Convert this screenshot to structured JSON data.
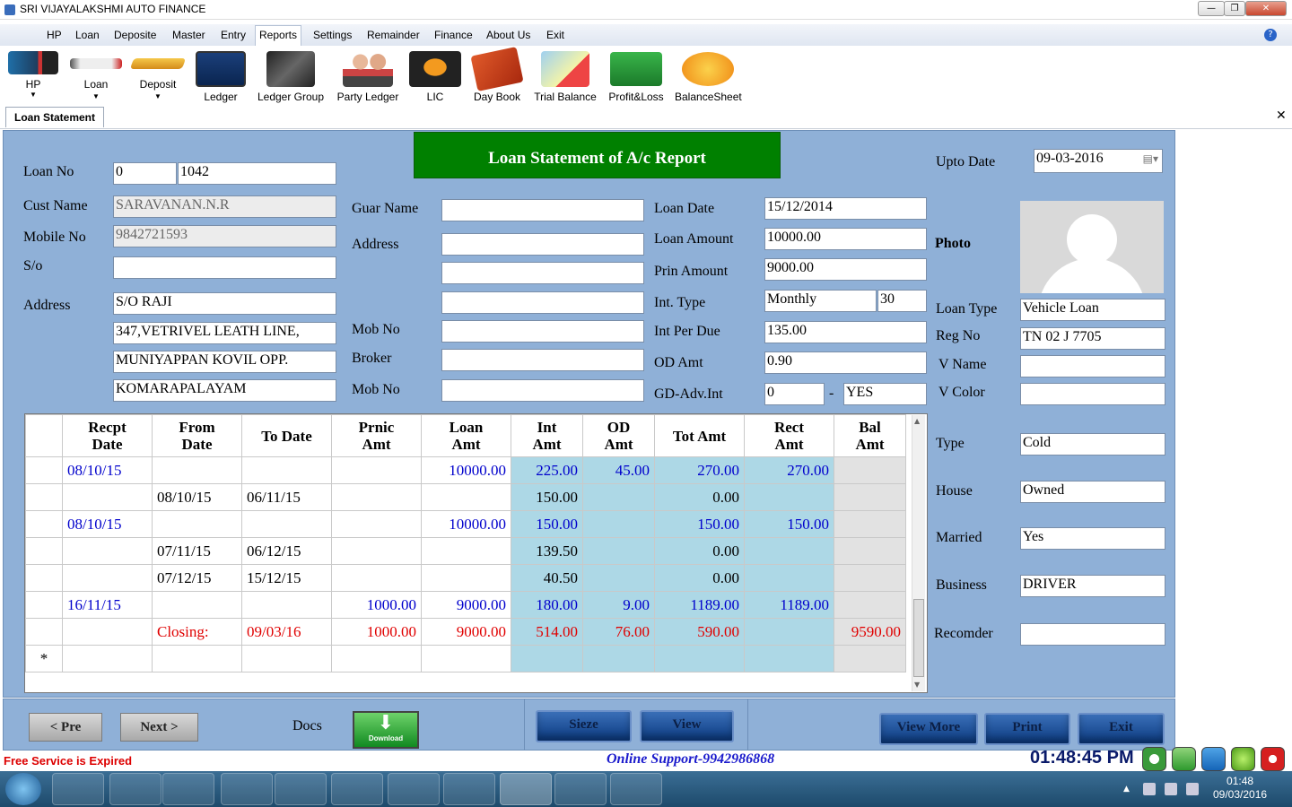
{
  "app": {
    "title": "SRI VIJAYALAKSHMI AUTO FINANCE"
  },
  "menu": [
    "HP",
    "Loan",
    "Deposite",
    "Master",
    "Entry",
    "Reports",
    "Settings",
    "Remainder",
    "Finance",
    "About Us",
    "Exit"
  ],
  "toolbar": [
    "HP",
    "Loan",
    "Deposit",
    "Ledger",
    "Ledger Group",
    "Party Ledger",
    "LIC",
    "Day Book",
    "Trial Balance",
    "Profit&Loss",
    "BalanceSheet"
  ],
  "tab": {
    "label": "Loan Statement"
  },
  "form": {
    "report_title": "Loan Statement of A/c Report",
    "upto_date_label": "Upto Date",
    "upto_date": "09-03-2016",
    "loan_no_label": "Loan No",
    "loan_no_prefix": "0",
    "loan_no": "1042",
    "cust_name_label": "Cust Name",
    "cust_name": "SARAVANAN.N.R",
    "mobile_label": "Mobile No",
    "mobile": "9842721593",
    "so_label": "S/o",
    "so": "",
    "address_label": "Address",
    "address": [
      "S/O RAJI",
      "347,VETRIVEL LEATH LINE,",
      "MUNIYAPPAN KOVIL OPP.",
      "KOMARAPALAYAM"
    ],
    "guar_name_label": "Guar Name",
    "guar_address_label": "Address",
    "guar_mob_label": "Mob No",
    "broker_label": "Broker",
    "broker_mob_label": "Mob No",
    "loan_date_label": "Loan Date",
    "loan_date": "15/12/2014",
    "loan_amount_label": "Loan Amount",
    "loan_amount": "10000.00",
    "prin_amount_label": "Prin Amount",
    "prin_amount": "9000.00",
    "int_type_label": "Int. Type",
    "int_type": "Monthly",
    "int_days": "30",
    "int_per_due_label": "Int Per Due",
    "int_per_due": "135.00",
    "od_amt_label": "OD Amt",
    "od_amt": "0.90",
    "gd_adv_label": "GD-Adv.Int",
    "gd_adv": "0",
    "gd_adv_sep": "-",
    "gd_adv_flag": "YES",
    "photo_label": "Photo",
    "loan_type_label": "Loan Type",
    "loan_type": "Vehicle Loan",
    "reg_no_label": "Reg No",
    "reg_no": "TN 02 J 7705",
    "v_name_label": "V Name",
    "v_color_label": "V Color",
    "type_label": "Type",
    "type": "Cold",
    "house_label": "House",
    "house": "Owned",
    "married_label": "Married",
    "married": "Yes",
    "business_label": "Business",
    "business": "DRIVER",
    "recomder_label": "Recomder"
  },
  "grid": {
    "headers": [
      [
        "Recpt",
        "Date"
      ],
      [
        "From",
        "Date"
      ],
      [
        "To Date",
        ""
      ],
      [
        "Prnic",
        "Amt"
      ],
      [
        "Loan",
        "Amt"
      ],
      [
        "Int",
        "Amt"
      ],
      [
        "OD",
        "Amt"
      ],
      [
        "Tot Amt",
        ""
      ],
      [
        "Rect",
        "Amt"
      ],
      [
        "Bal",
        "Amt"
      ]
    ],
    "rows": [
      {
        "c": [
          "08/10/15",
          "",
          "",
          "",
          "10000.00",
          "225.00",
          "45.00",
          "270.00",
          "270.00",
          ""
        ],
        "color": "blue"
      },
      {
        "c": [
          "",
          "08/10/15",
          "06/11/15",
          "",
          "",
          "150.00",
          "",
          "0.00",
          "",
          ""
        ],
        "color": "black"
      },
      {
        "c": [
          "08/10/15",
          "",
          "",
          "",
          "10000.00",
          "150.00",
          "",
          "150.00",
          "150.00",
          ""
        ],
        "color": "blue"
      },
      {
        "c": [
          "",
          "07/11/15",
          "06/12/15",
          "",
          "",
          "139.50",
          "",
          "0.00",
          "",
          ""
        ],
        "color": "black"
      },
      {
        "c": [
          "",
          "07/12/15",
          "15/12/15",
          "",
          "",
          "40.50",
          "",
          "0.00",
          "",
          ""
        ],
        "color": "black"
      },
      {
        "c": [
          "16/11/15",
          "",
          "",
          "1000.00",
          "9000.00",
          "180.00",
          "9.00",
          "1189.00",
          "1189.00",
          ""
        ],
        "color": "blue"
      },
      {
        "c": [
          "",
          "Closing:",
          "09/03/16",
          "1000.00",
          "9000.00",
          "514.00",
          "76.00",
          "590.00",
          "",
          "9590.00"
        ],
        "color": "red"
      }
    ],
    "new_row_marker": "*"
  },
  "buttons": {
    "pre": "< Pre",
    "next": "Next >",
    "docs_label": "Docs",
    "download": "Download",
    "sieze": "Sieze",
    "view": "View",
    "view_more": "View More",
    "print": "Print",
    "exit": "Exit"
  },
  "status": {
    "expired": "Free Service is Expired",
    "support": "Online Support-9942986868",
    "clock": "01:48:45 PM"
  },
  "tray": {
    "time": "01:48",
    "date": "09/03/2016"
  },
  "colors": {
    "panel": "#8fb0d7",
    "header_green": "#008000",
    "grid_blue": "#add8e6",
    "text_blue": "#0000cc",
    "text_red": "#e00000"
  }
}
